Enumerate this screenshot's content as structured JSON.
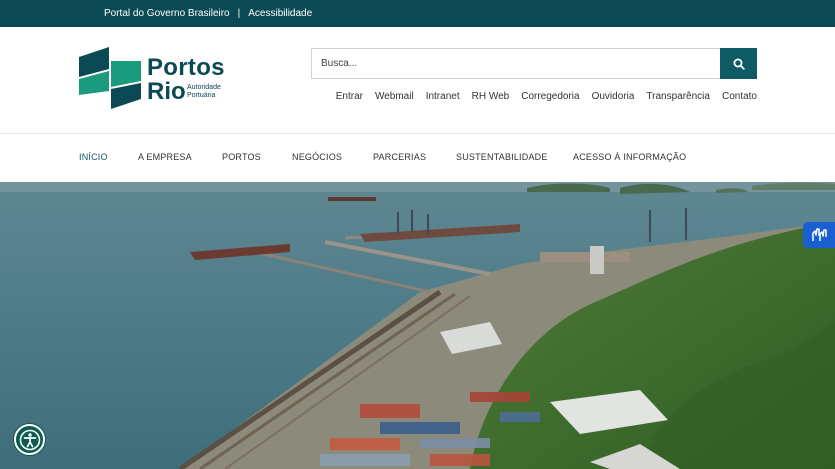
{
  "topbar": {
    "portal_label": "Portal do Governo Brasileiro",
    "separator": "|",
    "accessibility_label": "Acessibilidade"
  },
  "logo": {
    "word1": "Portos",
    "word2": "Rio",
    "subtitle_line1": "Autoridade",
    "subtitle_line2": "Portuária"
  },
  "search": {
    "placeholder": "Busca...",
    "button_icon": "search-icon"
  },
  "utility_links": [
    "Entrar",
    "Webmail",
    "Intranet",
    "RH Web",
    "Corregedoria",
    "Ouvidoria",
    "Transparência",
    "Contato"
  ],
  "nav": {
    "items": [
      "INÍCIO",
      "A EMPRESA",
      "PORTOS",
      "NEGÓCIOS",
      "PARCERIAS",
      "SUSTENTABILIDADE",
      "ACESSO À INFORMAÇÃO"
    ],
    "active": "INÍCIO"
  },
  "widgets": {
    "accessibility_icon": "accessibility-icon",
    "vlibras_icon": "sign-language-hands-icon"
  },
  "colors": {
    "topbar": "#0b4a55",
    "brand_dark": "#0b4a55",
    "brand_green": "#1a9b7e",
    "search_button": "#0e5b66",
    "accessibility_button": "#0c5b4f",
    "vlibras": "#1a5fd1"
  }
}
